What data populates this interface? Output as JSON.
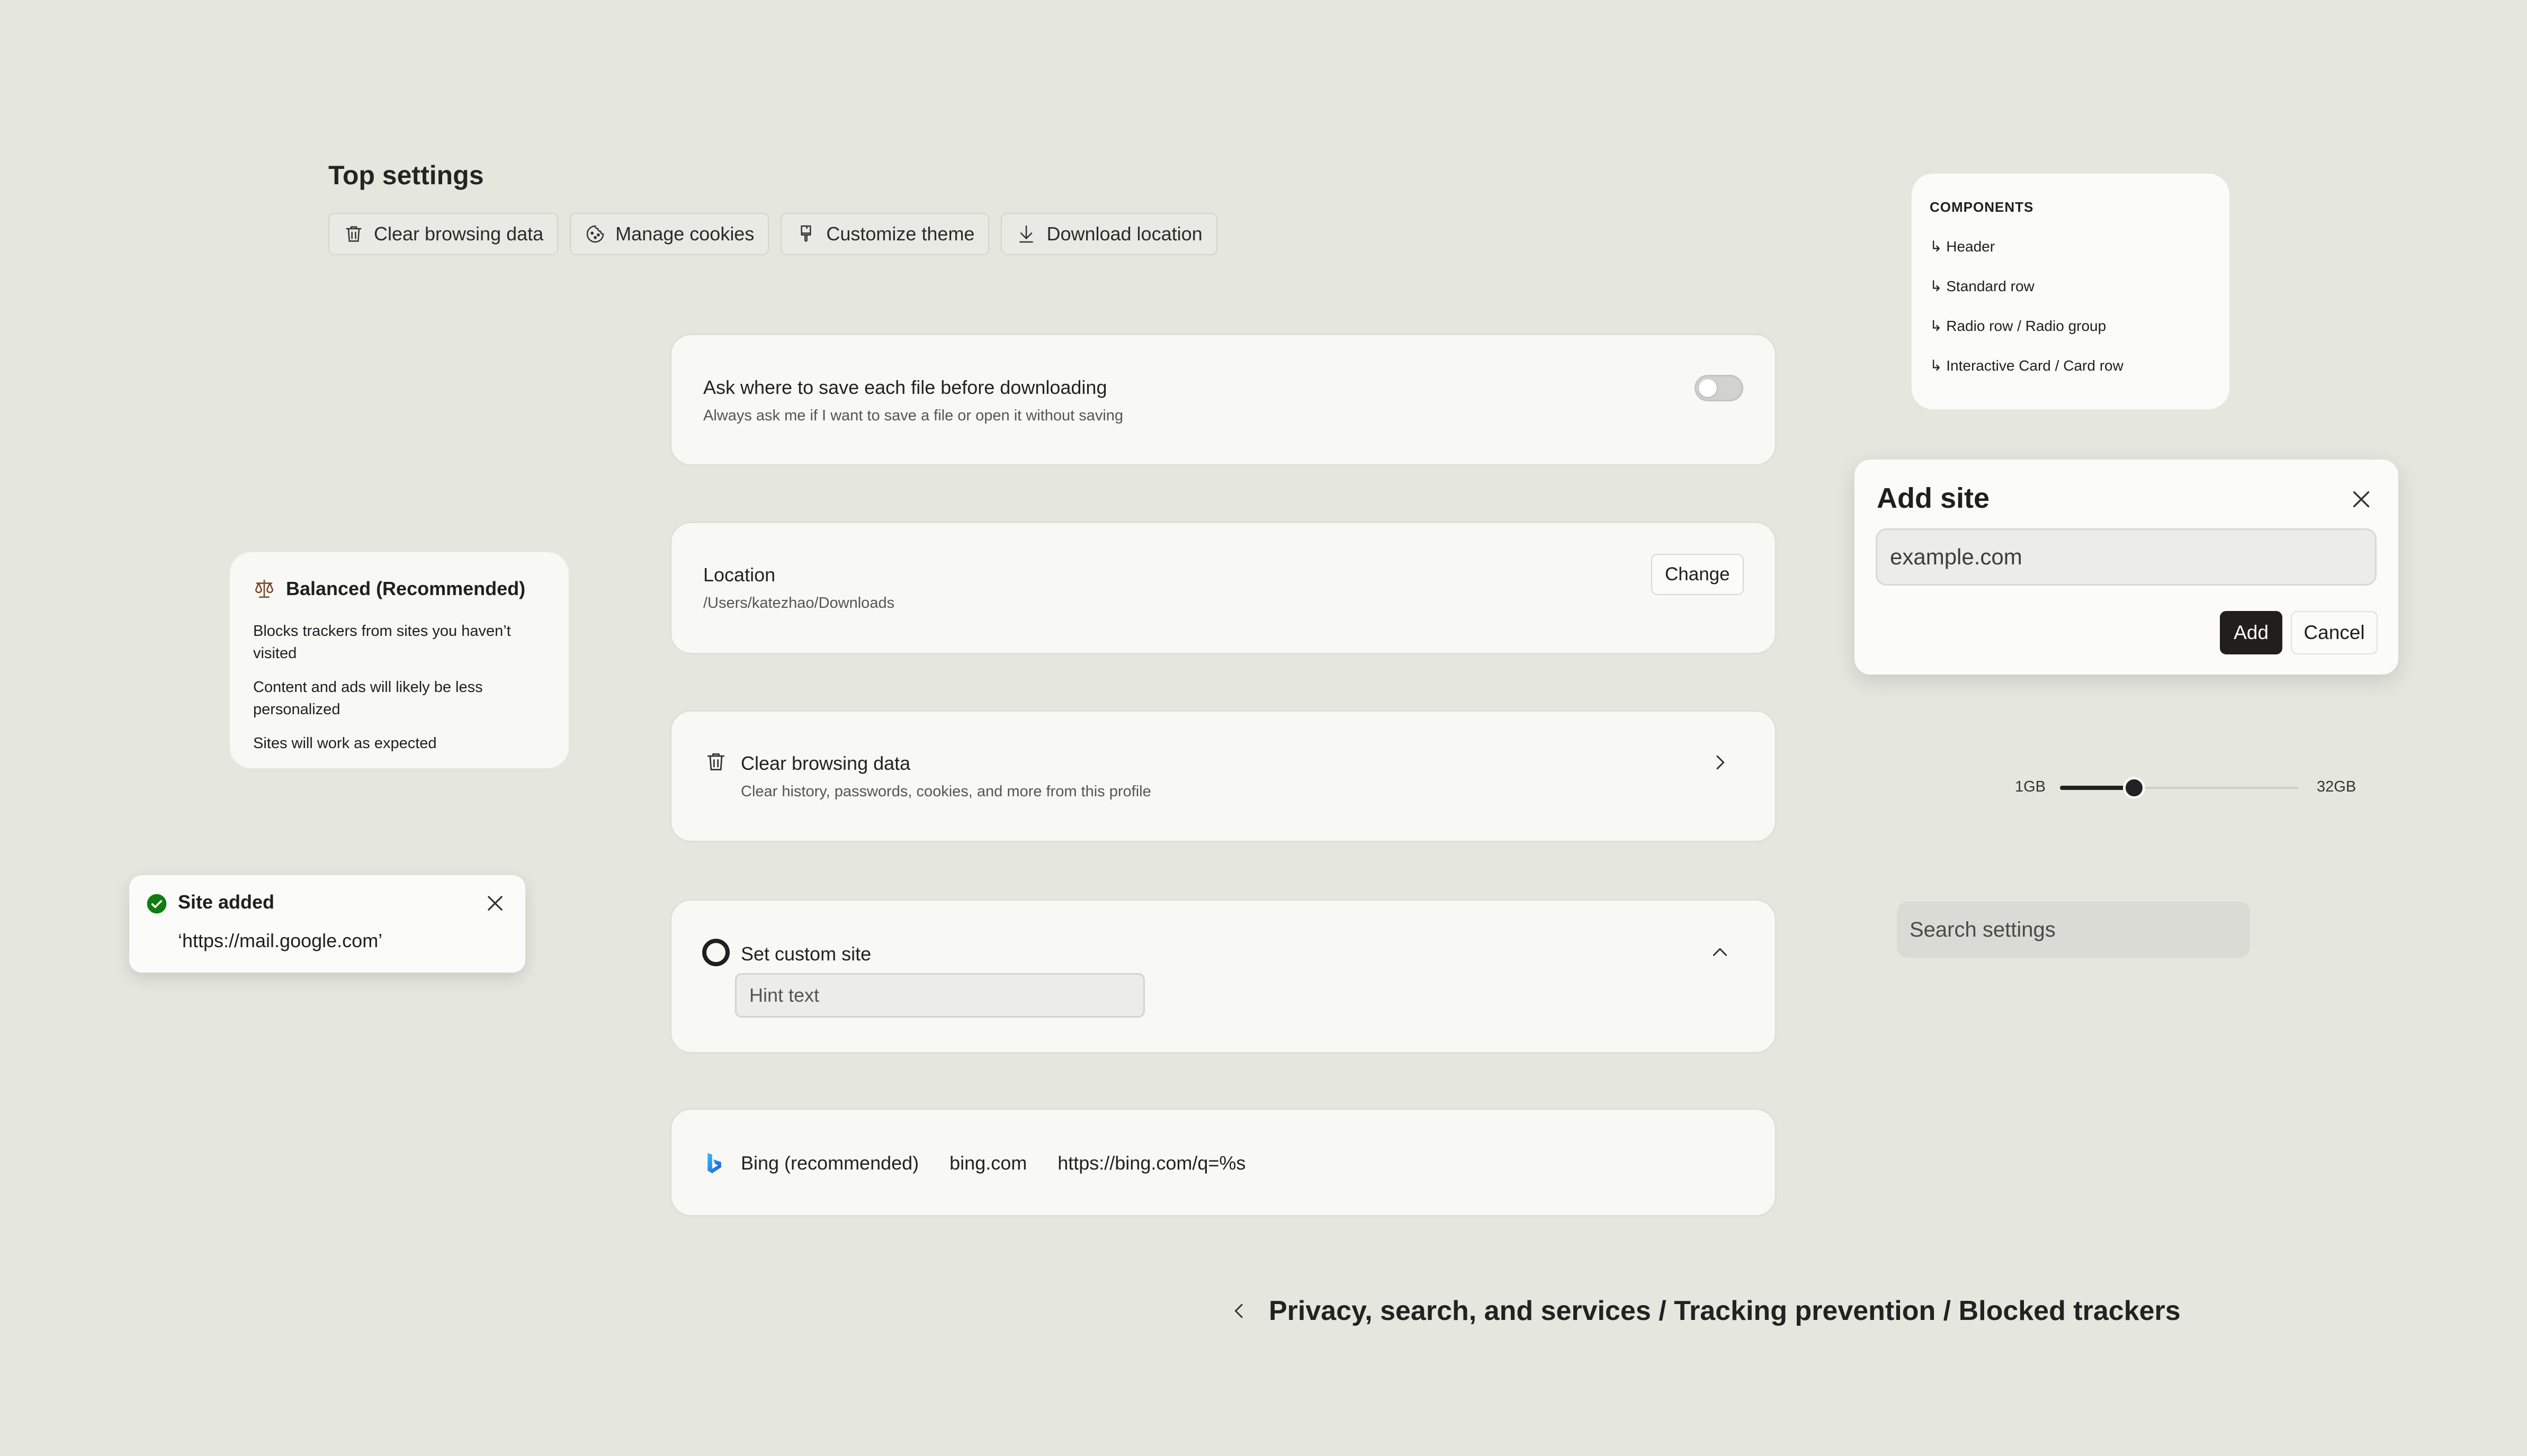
{
  "top_settings": {
    "title": "Top settings",
    "chips": [
      {
        "label": "Clear browsing data",
        "icon": "trash-icon"
      },
      {
        "label": "Manage cookies",
        "icon": "cookie-icon"
      },
      {
        "label": "Customize theme",
        "icon": "paint-brush-icon"
      },
      {
        "label": "Download location",
        "icon": "download-icon"
      }
    ]
  },
  "ask_row": {
    "title": "Ask where to save each file before downloading",
    "subtitle": "Always ask me if I want to save a file or open it without saving",
    "toggle_on": false
  },
  "location_row": {
    "title": "Location",
    "subtitle": "/Users/katezhao/Downloads",
    "button": "Change"
  },
  "clear_row": {
    "title": "Clear browsing data",
    "subtitle": "Clear history, passwords, cookies, and more from this profile",
    "icon": "trash-icon"
  },
  "custom_site_row": {
    "title": "Set custom site",
    "placeholder": "Hint text",
    "selected": true,
    "expanded": true
  },
  "search_engine_row": {
    "name": "Bing (recommended)",
    "domain": "bing.com",
    "url": "https://bing.com/q=%s",
    "icon": "bing-icon"
  },
  "components": {
    "heading": "COMPONENTS",
    "items": [
      "↳ Header",
      "↳ Standard row",
      "↳ Radio row / Radio group",
      "↳ Interactive Card / Card row"
    ]
  },
  "add_site_dialog": {
    "title": "Add site",
    "placeholder": "example.com",
    "add_label": "Add",
    "cancel_label": "Cancel"
  },
  "slider": {
    "min_label": "1GB",
    "max_label": "32GB",
    "fraction": 0.31
  },
  "search": {
    "placeholder": "Search settings"
  },
  "balanced": {
    "title": "Balanced (Recommended)",
    "points": [
      "Blocks trackers from sites you haven’t visited",
      "Content and ads will likely be less personalized",
      "Sites will work as expected"
    ]
  },
  "toast": {
    "title": "Site added",
    "message": "‘https://mail.google.com’",
    "status_color": "#107c10"
  },
  "breadcrumb": {
    "text": "Privacy, search, and services / Tracking prevention / Blocked trackers"
  }
}
